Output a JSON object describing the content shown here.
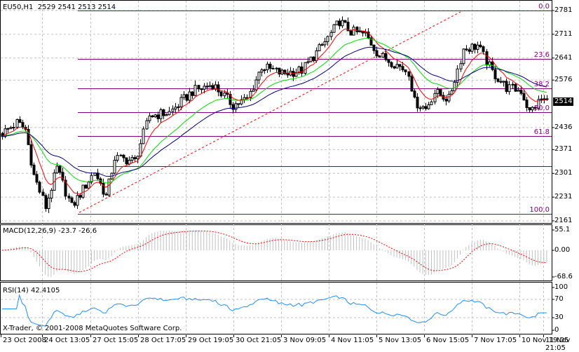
{
  "header": {
    "symbol_label": "EU50,H1",
    "ohlc": "2529 2541 2513 2514"
  },
  "current_price": "2514",
  "price_axis": [
    "2781",
    "2711",
    "2641",
    "2576",
    "2436",
    "2371",
    "2301",
    "2231",
    "2161"
  ],
  "fibonacci": {
    "levels": [
      "0.0",
      "23.6",
      "38.2",
      "50.0",
      "61.8",
      "",
      "100.0"
    ]
  },
  "macd": {
    "label": "MACD(12,26,9) -23.7 -26.6",
    "axis": [
      "55.1",
      "0.00",
      "-68.6"
    ]
  },
  "rsi": {
    "label": "RSI(14) 42.4105",
    "axis": [
      "100",
      "70",
      "30",
      "0"
    ]
  },
  "copyright": "X-Trader, © 2001-2008 MetaQuotes Software Corp.",
  "time_axis": [
    "23 Oct 2008",
    "24 Oct 13:05",
    "27 Oct 15:05",
    "28 Oct 17:05",
    "29 Oct 19:05",
    "30 Oct 21:05",
    "3 Nov 09:05",
    "4 Nov 11:05",
    "5 Nov 13:05",
    "6 Nov 15:05",
    "7 Nov 17:05",
    "10 Nov 19:05",
    "11 Nov 21:05"
  ],
  "colors": {
    "bull": "#ffffff",
    "bear": "#000000",
    "ma_fast": "#ff0000",
    "ma_mid": "#00dd00",
    "ma_slow": "#000080",
    "fib": "#800080",
    "trend": "#ff0000",
    "rsi": "#1e90ff",
    "macd_hist": "#c0c0c0",
    "macd_signal": "#ff0000",
    "grid": "#c0c0c0"
  },
  "chart_data": {
    "type": "candlestick",
    "symbol": "EU50",
    "timeframe": "H1",
    "ylim": [
      2161,
      2781
    ],
    "bars": 190,
    "close_path": [
      [
        0,
        2419
      ],
      [
        5,
        2450
      ],
      [
        8,
        2430
      ],
      [
        11,
        2295
      ],
      [
        15,
        2202
      ],
      [
        19,
        2316
      ],
      [
        24,
        2202
      ],
      [
        32,
        2306
      ],
      [
        36,
        2233
      ],
      [
        39,
        2347
      ],
      [
        46,
        2337
      ],
      [
        51,
        2471
      ],
      [
        58,
        2480
      ],
      [
        66,
        2543
      ],
      [
        73,
        2564
      ],
      [
        80,
        2502
      ],
      [
        85,
        2520
      ],
      [
        90,
        2616
      ],
      [
        97,
        2595
      ],
      [
        104,
        2605
      ],
      [
        112,
        2688
      ],
      [
        117,
        2750
      ],
      [
        121,
        2719
      ],
      [
        126,
        2710
      ],
      [
        131,
        2647
      ],
      [
        136,
        2626
      ],
      [
        141,
        2600
      ],
      [
        143,
        2512
      ],
      [
        147,
        2492
      ],
      [
        150,
        2540
      ],
      [
        155,
        2520
      ],
      [
        160,
        2667
      ],
      [
        165,
        2678
      ],
      [
        170,
        2600
      ],
      [
        175,
        2554
      ],
      [
        180,
        2545
      ],
      [
        183,
        2481
      ],
      [
        187,
        2520
      ],
      [
        189,
        2514
      ]
    ],
    "fib_range": [
      2781,
      2181
    ]
  }
}
